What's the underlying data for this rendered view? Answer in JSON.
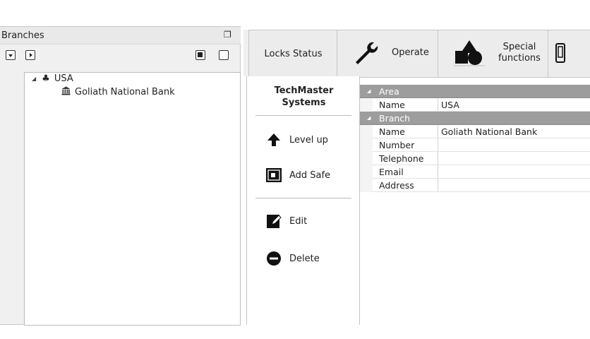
{
  "branches_panel": {
    "title": "Branches",
    "restore_icon": "restore-window-icon",
    "toolbar_icons": [
      "expand-all-icon",
      "expand-icon",
      "stop-icon",
      "square-icon"
    ],
    "tree": [
      {
        "label": "USA",
        "icon": "group-icon",
        "expanded": true,
        "level": 0
      },
      {
        "label": "Goliath National Bank",
        "icon": "bank-icon",
        "level": 1
      }
    ]
  },
  "toolbar": {
    "locks_status": "Locks Status",
    "operate": "Operate",
    "special_line1": "Special",
    "special_line2": "functions"
  },
  "actions": {
    "brand_line1": "TechMaster",
    "brand_line2": "Systems",
    "level_up": "Level up",
    "add_safe": "Add Safe",
    "edit": "Edit",
    "delete": "Delete"
  },
  "properties": {
    "area": {
      "category": "Area",
      "rows": [
        {
          "key": "Name",
          "value": "USA"
        }
      ]
    },
    "branch": {
      "category": "Branch",
      "rows": [
        {
          "key": "Name",
          "value": "Goliath National Bank"
        },
        {
          "key": "Number",
          "value": ""
        },
        {
          "key": "Telephone",
          "value": ""
        },
        {
          "key": "Email",
          "value": ""
        },
        {
          "key": "Address",
          "value": ""
        }
      ]
    }
  },
  "colors": {
    "category_bg": "#9d9d9d",
    "panel_bg": "#f0f0f0"
  }
}
